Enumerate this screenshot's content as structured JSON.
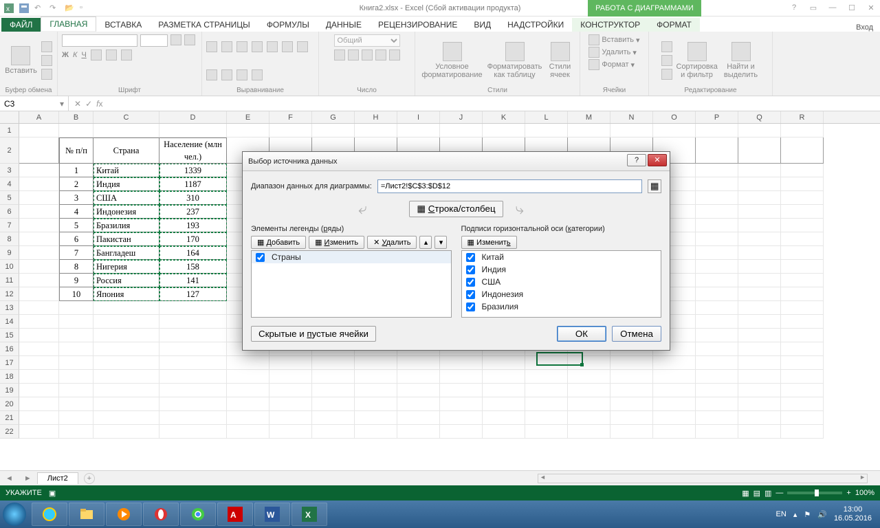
{
  "titlebar": {
    "title": "Книга2.xlsx - Excel (Сбой активации продукта)",
    "chart_tools": "РАБОТА С ДИАГРАММАМИ",
    "login": "Вход"
  },
  "tabs": {
    "file": "ФАЙЛ",
    "home": "ГЛАВНАЯ",
    "insert": "ВСТАВКА",
    "layout": "РАЗМЕТКА СТРАНИЦЫ",
    "formulas": "ФОРМУЛЫ",
    "data": "ДАННЫЕ",
    "review": "РЕЦЕНЗИРОВАНИЕ",
    "view": "ВИД",
    "addins": "НАДСТРОЙКИ",
    "design": "КОНСТРУКТОР",
    "format": "ФОРМАТ"
  },
  "ribbon": {
    "clipboard": {
      "paste": "Вставить",
      "label": "Буфер обмена"
    },
    "font": {
      "bold": "Ж",
      "italic": "К",
      "underline": "Ч",
      "label": "Шрифт"
    },
    "align": {
      "label": "Выравнивание"
    },
    "number": {
      "format": "Общий",
      "label": "Число"
    },
    "styles": {
      "cond": "Условное форматирование",
      "table": "Форматировать как таблицу",
      "cell": "Стили ячеек",
      "label": "Стили"
    },
    "cells": {
      "insert": "Вставить",
      "delete": "Удалить",
      "format": "Формат",
      "label": "Ячейки"
    },
    "editing": {
      "sort": "Сортировка и фильтр",
      "find": "Найти и выделить",
      "label": "Редактирование"
    }
  },
  "namebox": "C3",
  "columns": [
    "A",
    "B",
    "C",
    "D",
    "E",
    "F",
    "G",
    "H",
    "I",
    "J",
    "K",
    "L",
    "M",
    "N",
    "O",
    "P",
    "Q",
    "R"
  ],
  "tableHeader": {
    "num": "№ п/п",
    "country": "Страна",
    "pop": "Население (млн чел.)"
  },
  "tableRows": [
    {
      "n": "1",
      "country": "Китай",
      "pop": "1339"
    },
    {
      "n": "2",
      "country": "Индия",
      "pop": "1187"
    },
    {
      "n": "3",
      "country": "США",
      "pop": "310"
    },
    {
      "n": "4",
      "country": "Индонезия",
      "pop": "237"
    },
    {
      "n": "5",
      "country": "Бразилия",
      "pop": "193"
    },
    {
      "n": "6",
      "country": "Пакистан",
      "pop": "170"
    },
    {
      "n": "7",
      "country": "Бангладеш",
      "pop": "164"
    },
    {
      "n": "8",
      "country": "Нигерия",
      "pop": "158"
    },
    {
      "n": "9",
      "country": "Россия",
      "pop": "141"
    },
    {
      "n": "10",
      "country": "Япония",
      "pop": "127"
    }
  ],
  "dialog": {
    "title": "Выбор источника данных",
    "rangeLabel": "Диапазон данных для диаграммы:",
    "rangeValue": "=Лист2!$C$3:$D$12",
    "swap": "Строка/столбец",
    "legendLabel": "Элементы легенды (ряды)",
    "axisLabel": "Подписи горизонтальной оси (категории)",
    "add": "Добавить",
    "edit": "Изменить",
    "delete": "Удалить",
    "edit2": "Изменить",
    "series": [
      "Страны"
    ],
    "categories": [
      "Китай",
      "Индия",
      "США",
      "Индонезия",
      "Бразилия"
    ],
    "hidden": "Скрытые и пустые ячейки",
    "ok": "ОК",
    "cancel": "Отмена"
  },
  "sheet": {
    "name": "Лист2"
  },
  "status": {
    "mode": "УКАЖИТЕ",
    "zoom": "100%"
  },
  "tray": {
    "lang": "EN",
    "time": "13:00",
    "date": "16.05.2016"
  }
}
